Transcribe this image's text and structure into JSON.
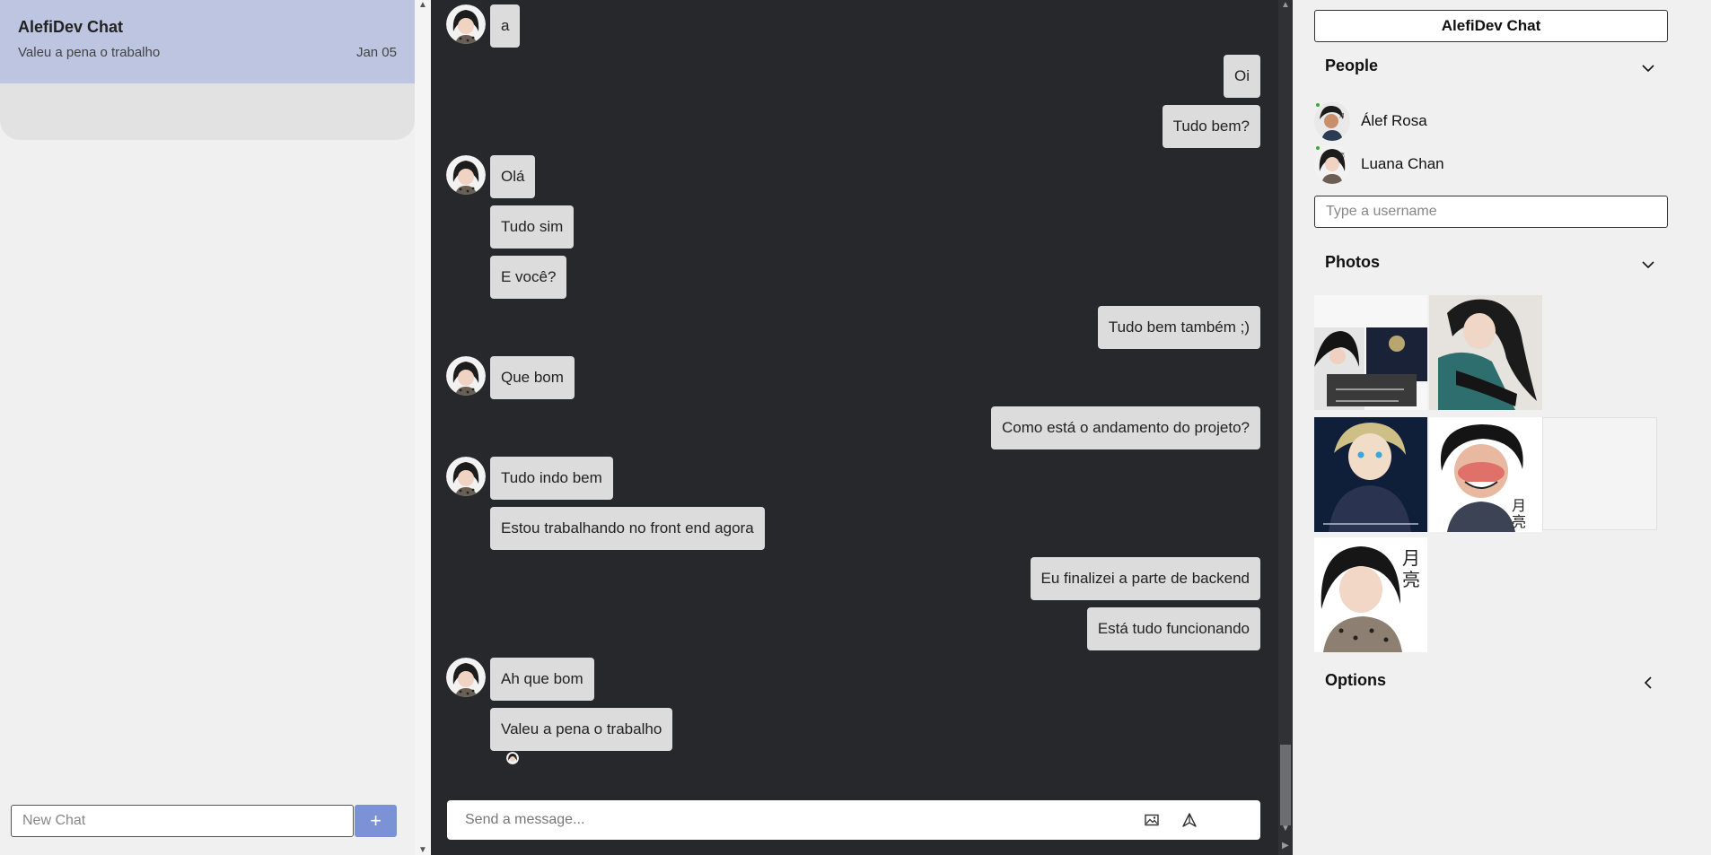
{
  "sidebar": {
    "chats": [
      {
        "title": "AlefiDev Chat",
        "last_message": "Valeu a pena o trabalho",
        "date": "Jan 05"
      }
    ],
    "new_chat_placeholder": "New Chat",
    "new_chat_button_label": "+"
  },
  "feed": {
    "messages": [
      {
        "text": "a",
        "direction": "in"
      },
      {
        "text": "Oi",
        "direction": "out"
      },
      {
        "text": "Tudo bem?",
        "direction": "out"
      },
      {
        "text": "Olá",
        "direction": "in"
      },
      {
        "text": "Tudo sim",
        "direction": "in"
      },
      {
        "text": "E você?",
        "direction": "in"
      },
      {
        "text": "Tudo bem também ;)",
        "direction": "out"
      },
      {
        "text": "Que bom",
        "direction": "in"
      },
      {
        "text": "Como está o andamento do projeto?",
        "direction": "out"
      },
      {
        "text": "Tudo indo bem",
        "direction": "in"
      },
      {
        "text": "Estou trabalhando no front end agora",
        "direction": "in"
      },
      {
        "text": "Eu finalizei a parte de backend",
        "direction": "out"
      },
      {
        "text": "Está tudo funcionando",
        "direction": "out"
      },
      {
        "text": "Ah que bom",
        "direction": "in"
      },
      {
        "text": "Valeu a pena o trabalho",
        "direction": "in"
      }
    ],
    "composer_placeholder": "Send a message...",
    "icons": {
      "image_upload": "image-icon",
      "send": "send-icon"
    }
  },
  "panel": {
    "title": "AlefiDev Chat",
    "people_heading": "People",
    "people": [
      {
        "name": "Álef Rosa",
        "online": true
      },
      {
        "name": "Luana Chan",
        "online": true
      }
    ],
    "username_placeholder": "Type a username",
    "photos_heading": "Photos",
    "options_heading": "Options"
  },
  "colors": {
    "sidebar_bg": "#f0f0f0",
    "chat_card_bg": "#bdc5e0",
    "feed_bg": "#26282b",
    "bubble_bg": "#dcdcdc",
    "accent": "#7b93d6",
    "online": "#3aaa35"
  }
}
